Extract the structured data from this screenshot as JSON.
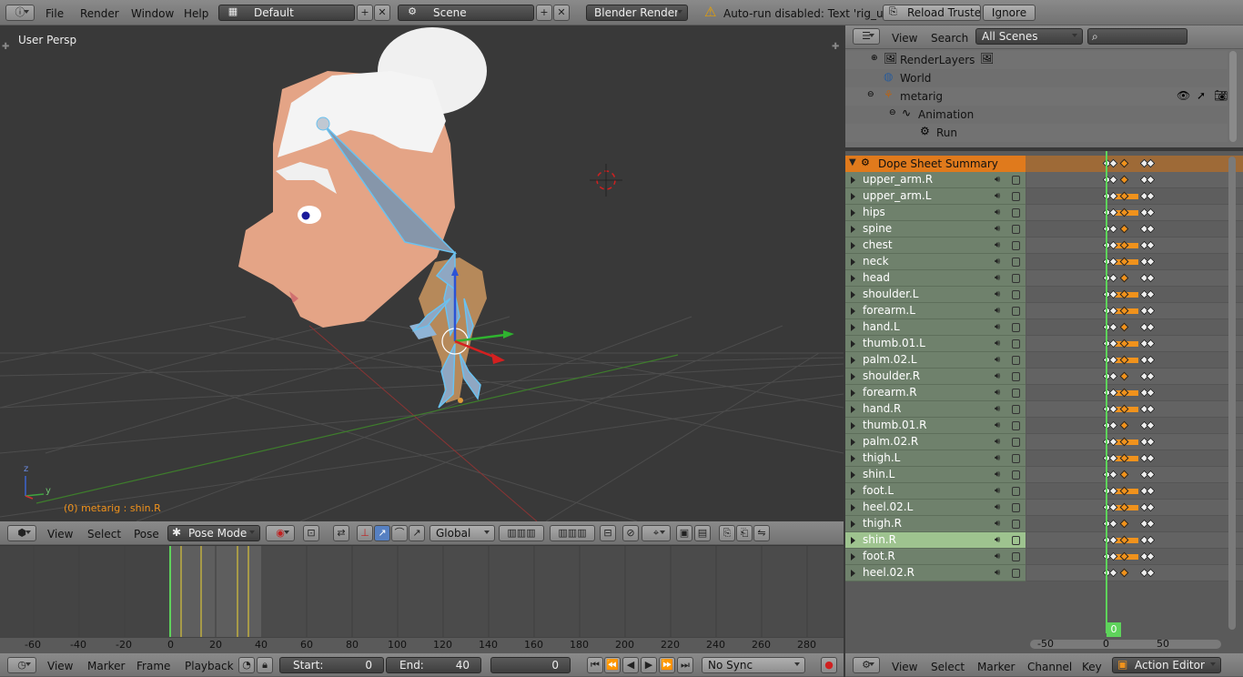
{
  "topbar": {
    "menus": [
      "File",
      "Render",
      "Window",
      "Help"
    ],
    "layout": "Default",
    "scene": "Scene",
    "engine": "Blender Render",
    "warning": "Auto-run disabled: Text 'rig_ui.py'",
    "reload_trusted": "Reload Trusted",
    "ignore": "Ignore"
  },
  "viewport": {
    "label": "User Persp",
    "status": "(0) metarig : shin.R",
    "axis_z": "z",
    "axis_y": "y",
    "header": {
      "menus": [
        "View",
        "Select",
        "Pose"
      ],
      "mode": "Pose Mode",
      "orientation": "Global"
    }
  },
  "timeline": {
    "ticks": [
      "-60",
      "-40",
      "-20",
      "0",
      "20",
      "40",
      "60",
      "80",
      "100",
      "120",
      "140",
      "160",
      "180",
      "200",
      "220",
      "240",
      "260",
      "280"
    ],
    "header": {
      "menus": [
        "View",
        "Marker",
        "Frame",
        "Playback"
      ],
      "start_label": "Start:",
      "start_value": "0",
      "end_label": "End:",
      "end_value": "40",
      "current_frame": "0",
      "sync": "No Sync"
    }
  },
  "outliner": {
    "header": {
      "menus": [
        "View",
        "Search"
      ],
      "filter": "All Scenes"
    },
    "items": [
      {
        "label": "RenderLayers"
      },
      {
        "label": "World"
      },
      {
        "label": "metarig"
      },
      {
        "label": "Animation"
      },
      {
        "label": "Run"
      }
    ]
  },
  "dopesheet": {
    "summary": "Dope Sheet Summary",
    "channels": [
      "upper_arm.R",
      "upper_arm.L",
      "hips",
      "spine",
      "chest",
      "neck",
      "head",
      "shoulder.L",
      "forearm.L",
      "hand.L",
      "thumb.01.L",
      "palm.02.L",
      "shoulder.R",
      "forearm.R",
      "hand.R",
      "thumb.01.R",
      "palm.02.R",
      "thigh.L",
      "shin.L",
      "foot.L",
      "heel.02.L",
      "thigh.R",
      "shin.R",
      "foot.R",
      "heel.02.R"
    ],
    "selected": "shin.R",
    "current_frame": "0",
    "ticks": [
      "-50",
      "0",
      "50"
    ],
    "header": {
      "menus": [
        "View",
        "Select",
        "Marker",
        "Channel",
        "Key"
      ],
      "mode": "Action Editor"
    }
  },
  "colors": {
    "accent": "#f0921c",
    "channel": "#6f816c",
    "selected_channel": "#9ec38f",
    "frame_line": "#5ed35b"
  }
}
